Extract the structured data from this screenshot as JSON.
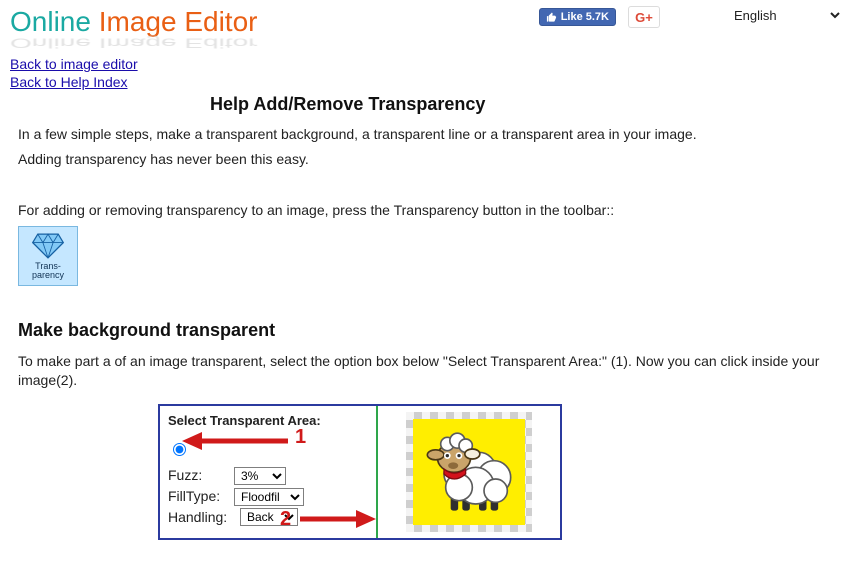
{
  "header": {
    "logo_word1": "Online",
    "logo_word2": "Image",
    "logo_word3": "Editor",
    "fb_like_label": "Like 5.7K",
    "gplus_label": "G+",
    "language": "English"
  },
  "nav": {
    "back_editor": "Back to image editor",
    "back_help": "Back to Help Index"
  },
  "page_title": "Help Add/Remove Transparency",
  "intro": {
    "p1": "In a few simple steps, make a transparent background, a transparent line or a transparent area in your image.",
    "p2": "Adding transparency has never been this easy.",
    "p3": "For adding or removing transparency to an image, press the Transparency button in the toolbar::"
  },
  "tool_button_label": "Trans-\nparency",
  "section_title": "Make background transparent",
  "section_text": "To make part a of an image transparent, select the option box below \"Select Transparent Area:\" (1). Now you can click inside your image(2).",
  "panel": {
    "heading": "Select Transparent Area:",
    "fuzz_label": "Fuzz:",
    "fuzz_value": "3%",
    "filltype_label": "FillType:",
    "filltype_value": "Floodfil",
    "handling_label": "Handling:",
    "handling_value": "Back",
    "annotation_1": "1",
    "annotation_2": "2"
  }
}
